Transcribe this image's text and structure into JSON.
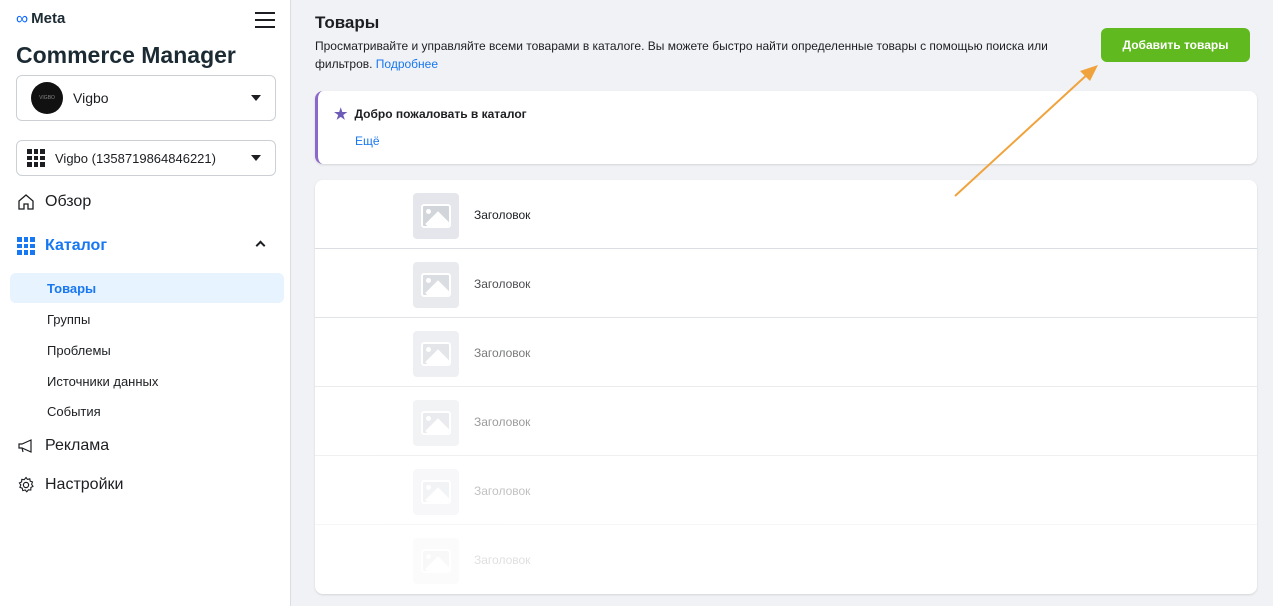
{
  "sidebar": {
    "brand": "Meta",
    "app_title": "Commerce Manager",
    "business": {
      "name": "Vigbo",
      "avatar_text": "VIGBO"
    },
    "catalog_selector": "Vigbo (1358719864846221)",
    "nav": {
      "overview": "Обзор",
      "catalog": "Каталог",
      "catalog_sub": [
        "Товары",
        "Группы",
        "Проблемы",
        "Источники данных",
        "События"
      ],
      "ads": "Реклама",
      "settings": "Настройки"
    }
  },
  "main": {
    "title": "Товары",
    "description": "Просматривайте и управляйте всеми товарами в каталоге. Вы можете быстро найти определенные товары с помощью поиска или фильтров.",
    "learn_more": "Подробнее",
    "add_button": "Добавить товары",
    "welcome": {
      "title": "Добро пожаловать в каталог",
      "more": "Ещё"
    },
    "products": [
      "Заголовок",
      "Заголовок",
      "Заголовок",
      "Заголовок",
      "Заголовок",
      "Заголовок"
    ]
  },
  "colors": {
    "accent": "#1877f2",
    "add_button": "#5fb91f",
    "welcome_border": "#8b68c9",
    "annotation_arrow": "#f0a33c"
  }
}
